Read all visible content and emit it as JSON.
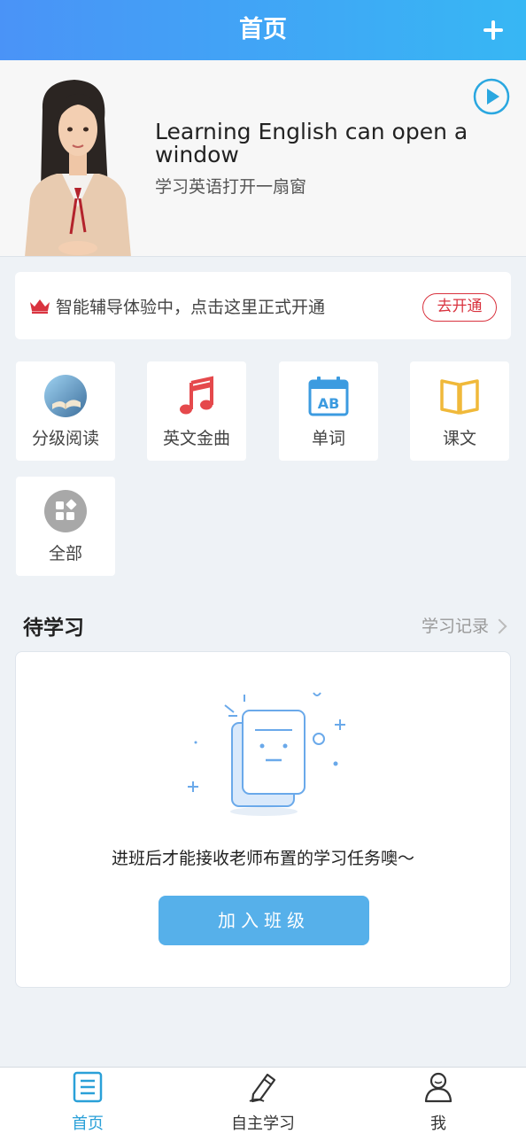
{
  "header": {
    "title": "首页",
    "add_icon": "plus-icon"
  },
  "banner": {
    "title_en": "Learning English can open a window",
    "title_zh": "学习英语打开一扇窗",
    "play_icon": "play-icon"
  },
  "promo": {
    "icon": "crown-icon",
    "text": "智能辅导体验中，点击这里正式开通",
    "button": "去开通",
    "accent": "#d9333f"
  },
  "features": [
    {
      "label": "分级阅读",
      "icon": "book-reading-icon"
    },
    {
      "label": "英文金曲",
      "icon": "music-note-icon"
    },
    {
      "label": "单词",
      "icon": "word-calendar-icon"
    },
    {
      "label": "课文",
      "icon": "open-book-icon"
    },
    {
      "label": "全部",
      "icon": "all-apps-icon"
    }
  ],
  "pending": {
    "title": "待学习",
    "history_link": "学习记录",
    "empty_message": "进班后才能接收老师布置的学习任务噢～",
    "join_button": "加入班级"
  },
  "bottom_nav": [
    {
      "label": "首页",
      "icon": "list-icon",
      "active": true
    },
    {
      "label": "自主学习",
      "icon": "pencil-icon",
      "active": false
    },
    {
      "label": "我",
      "icon": "user-icon",
      "active": false
    }
  ],
  "colors": {
    "header_start": "#4a93f7",
    "header_end": "#37b7f4",
    "primary": "#56b0ea",
    "active_nav": "#2aa0d8"
  }
}
